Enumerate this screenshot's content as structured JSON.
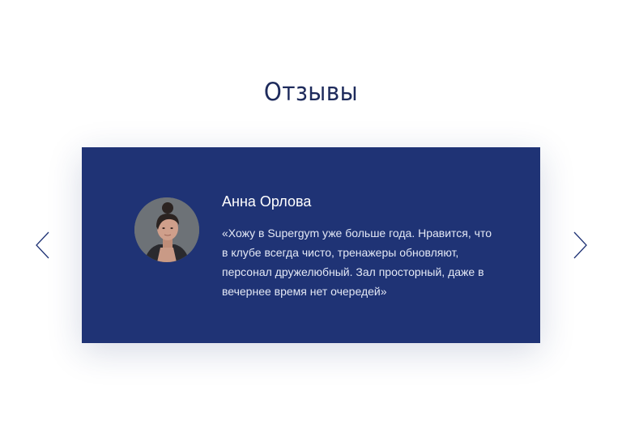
{
  "section": {
    "title": "Отзывы"
  },
  "review": {
    "name": "Анна Орлова",
    "text": "«Хожу в Supergym уже больше года. Нравится, что в клубе всегда чисто, тренажеры обновляют, персонал дружелюбный. Зал просторный, даже в вечернее время нет очередей»",
    "avatar_icon": "person-photo"
  },
  "navigation": {
    "prev_icon": "chevron-left-icon",
    "next_icon": "chevron-right-icon"
  },
  "colors": {
    "title": "#1e2b5c",
    "card_background": "#1f3375",
    "text_on_card": "#ffffff",
    "arrow": "#1f3375"
  }
}
